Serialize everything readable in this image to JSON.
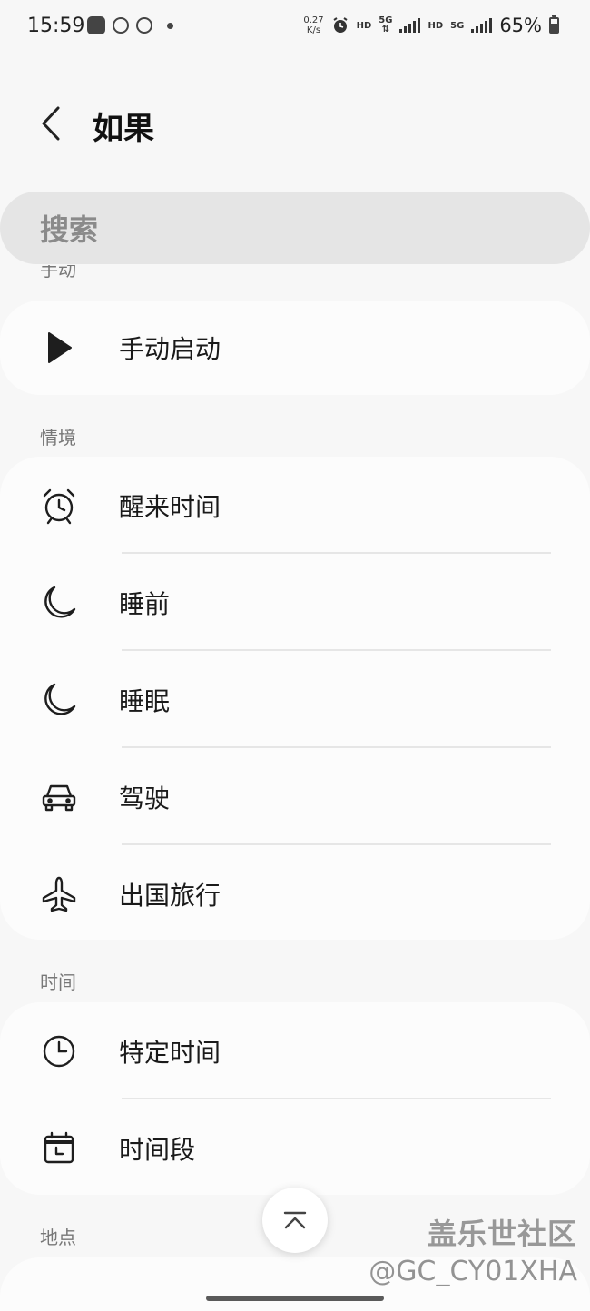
{
  "status_bar": {
    "time": "15:59",
    "net_speed_value": "0.27",
    "net_speed_unit": "K/s",
    "hd1": "HD",
    "net1": "5G",
    "hd2": "HD",
    "net2": "5G",
    "battery": "65%"
  },
  "header": {
    "title": "如果"
  },
  "search": {
    "placeholder": "搜索"
  },
  "sections": {
    "manual": {
      "label": "手动",
      "items": [
        {
          "label": "手动启动",
          "icon": "play-icon"
        }
      ]
    },
    "context": {
      "label": "情境",
      "items": [
        {
          "label": "醒来时间",
          "icon": "alarm-clock-icon"
        },
        {
          "label": "睡前",
          "icon": "moon-icon"
        },
        {
          "label": "睡眠",
          "icon": "moon-icon"
        },
        {
          "label": "驾驶",
          "icon": "car-icon"
        },
        {
          "label": "出国旅行",
          "icon": "airplane-icon"
        }
      ]
    },
    "time": {
      "label": "时间",
      "items": [
        {
          "label": "特定时间",
          "icon": "clock-icon"
        },
        {
          "label": "时间段",
          "icon": "calendar-clock-icon"
        }
      ]
    },
    "location": {
      "label": "地点"
    }
  },
  "watermark": {
    "line1": "盖乐世社区",
    "line2": "@GC_CY01XHA"
  }
}
